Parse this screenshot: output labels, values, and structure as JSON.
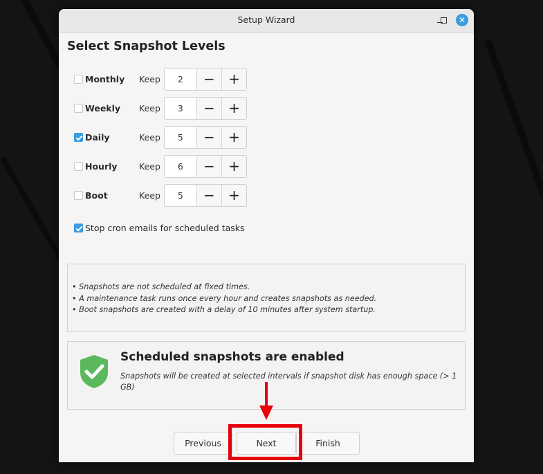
{
  "window": {
    "title": "Setup Wizard",
    "controls": {
      "minimize": "minimize",
      "maximize": "maximize",
      "close": "✕"
    }
  },
  "page": {
    "title": "Select Snapshot Levels"
  },
  "levels": [
    {
      "label": "Monthly",
      "checked": false,
      "keep_label": "Keep",
      "value": "2"
    },
    {
      "label": "Weekly",
      "checked": false,
      "keep_label": "Keep",
      "value": "3"
    },
    {
      "label": "Daily",
      "checked": true,
      "keep_label": "Keep",
      "value": "5"
    },
    {
      "label": "Hourly",
      "checked": false,
      "keep_label": "Keep",
      "value": "6"
    },
    {
      "label": "Boot",
      "checked": false,
      "keep_label": "Keep",
      "value": "5"
    }
  ],
  "spin": {
    "minus": "−",
    "plus": "+"
  },
  "cron": {
    "label": "Stop cron emails for scheduled tasks",
    "checked": true
  },
  "info": {
    "lines": [
      "• Snapshots are not scheduled at fixed times.",
      "• A maintenance task runs once every hour and creates snapshots as needed.",
      "• Boot snapshots are created with a delay of 10 minutes after system startup."
    ]
  },
  "status": {
    "title": "Scheduled snapshots are enabled",
    "description": "Snapshots will be created at selected intervals if snapshot disk has enough space (> 1 GB)",
    "icon": "shield-check-icon",
    "icon_color": "#5cb85c"
  },
  "buttons": {
    "previous": "Previous",
    "next": "Next",
    "finish": "Finish"
  },
  "colors": {
    "accent": "#3a9be0",
    "annotation": "#e8000b"
  }
}
